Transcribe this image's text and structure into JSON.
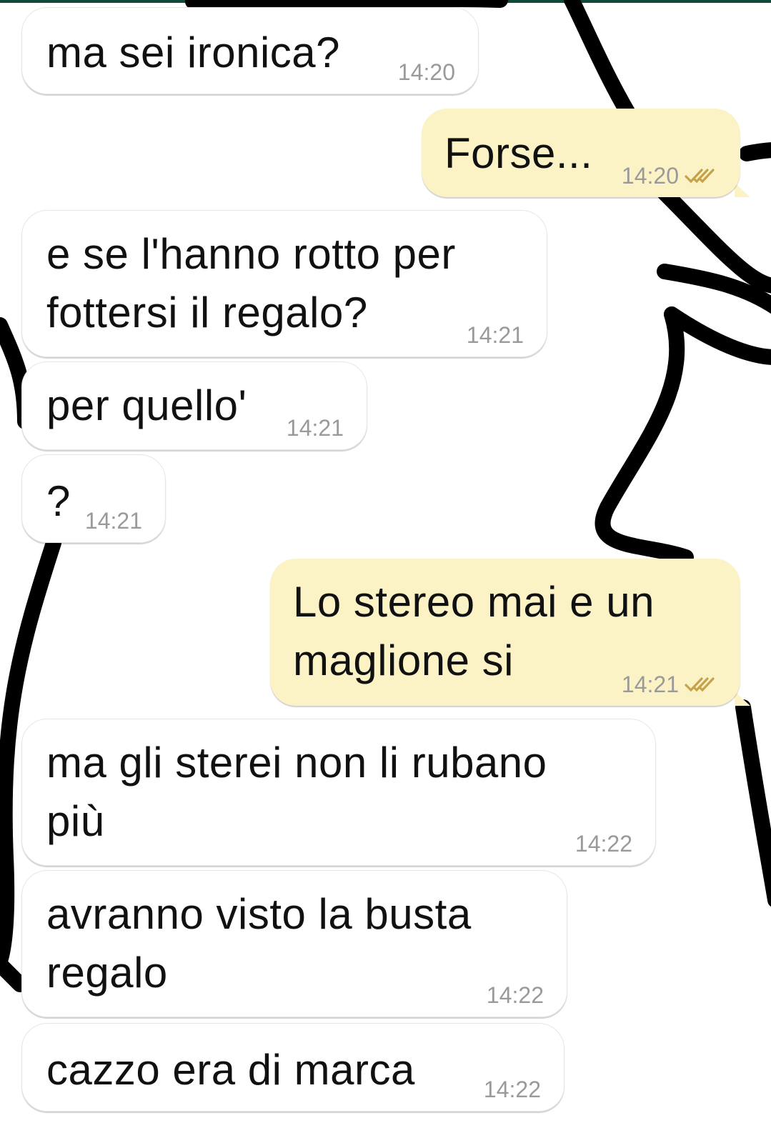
{
  "chat": {
    "messages": [
      {
        "dir": "in",
        "text": "ma sei ironica?",
        "time": "14:20"
      },
      {
        "dir": "out",
        "text": "Forse...",
        "time": "14:20",
        "status": "double-check-icon"
      },
      {
        "dir": "in",
        "text": "e se l'hanno rotto per\nfottersi il regalo?",
        "time": "14:21"
      },
      {
        "dir": "in",
        "text": "per quello'",
        "time": "14:21"
      },
      {
        "dir": "in",
        "text": "?",
        "time": "14:21"
      },
      {
        "dir": "out",
        "text": "Lo stereo mai e un\nmaglione si",
        "time": "14:21",
        "status": "double-check-icon"
      },
      {
        "dir": "in",
        "text": "ma gli sterei non li rubano\npiù",
        "time": "14:22"
      },
      {
        "dir": "in",
        "text": "avranno visto la busta\nregalo",
        "time": "14:22"
      },
      {
        "dir": "in",
        "text": "cazzo era di marca",
        "time": "14:22"
      }
    ]
  },
  "colors": {
    "incoming_bubble": "#ffffff",
    "outgoing_bubble": "#fbf3c6",
    "timestamp": "#9a9a9a",
    "read_ticks": "#c6a24a",
    "wallpaper_lines": "#000000"
  }
}
